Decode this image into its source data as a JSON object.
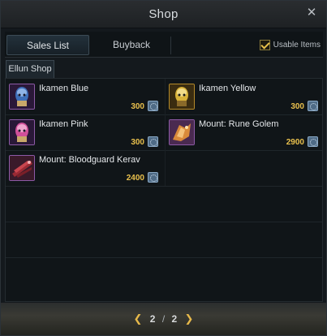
{
  "window": {
    "title": "Shop"
  },
  "tabs": [
    {
      "label": "Sales List",
      "active": true
    },
    {
      "label": "Buyback",
      "active": false
    }
  ],
  "filter": {
    "usable_items_label": "Usable Items",
    "checked": true
  },
  "subtab": {
    "label": "Ellun Shop"
  },
  "items": [
    {
      "name": "Ikamen Blue",
      "price": "300",
      "icon": "ikamen-blue-icon",
      "grade": "epic"
    },
    {
      "name": "Ikamen Yellow",
      "price": "300",
      "icon": "ikamen-yellow-icon",
      "grade": "legend"
    },
    {
      "name": "Ikamen Pink",
      "price": "300",
      "icon": "ikamen-pink-icon",
      "grade": "epic"
    },
    {
      "name": "Mount: Rune Golem",
      "price": "2900",
      "icon": "rune-golem-icon",
      "grade": "epic"
    },
    {
      "name": "Mount: Bloodguard Kerav",
      "price": "2400",
      "icon": "bloodguard-kerav-icon",
      "grade": "epic"
    }
  ],
  "pagination": {
    "current": "2",
    "separator": "/",
    "total": "2"
  },
  "colors": {
    "price": "#e9c04d",
    "accent": "#e7b94a"
  }
}
